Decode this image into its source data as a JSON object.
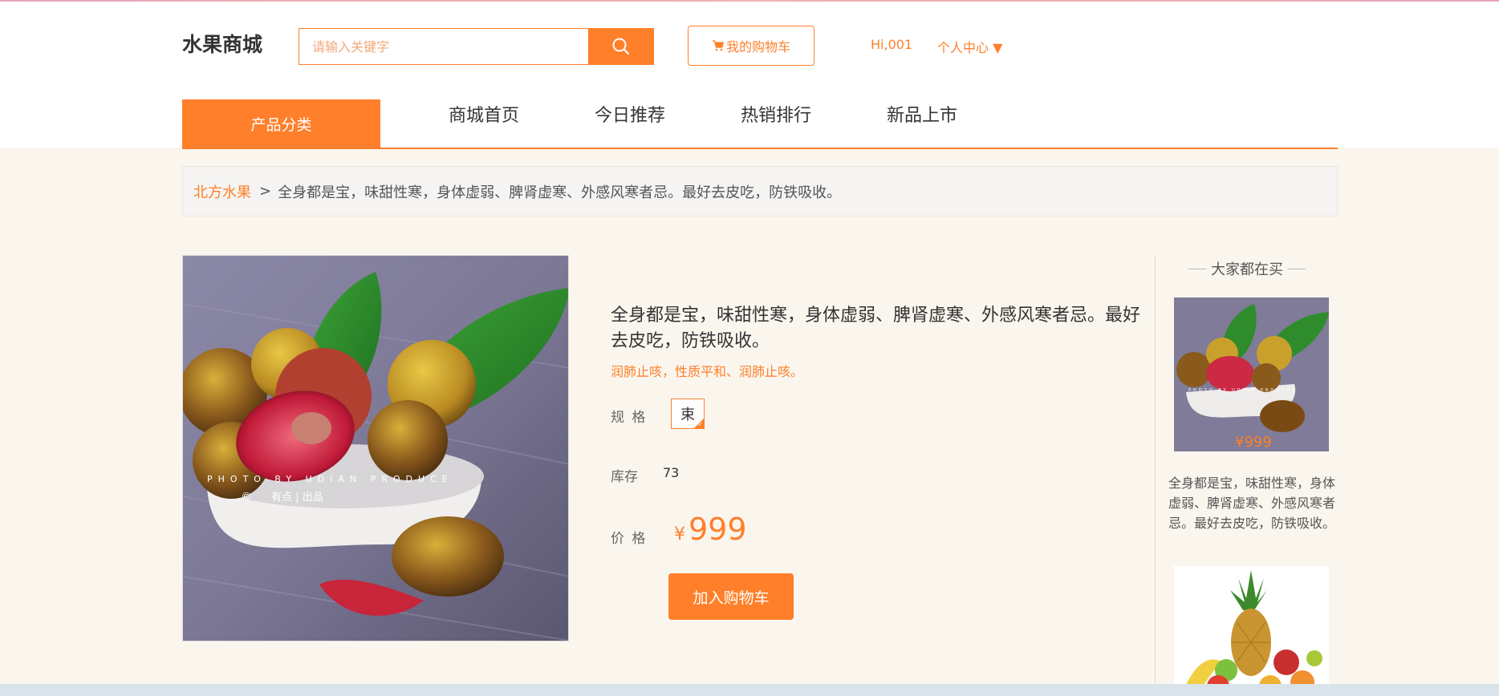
{
  "header": {
    "logo": "水果商城",
    "search_placeholder": "请输入关键字",
    "cart_label": "我的购物车",
    "greeting": "Hi,001",
    "user_center": "个人中心 ▼"
  },
  "nav": {
    "category": "产品分类",
    "items": [
      "商城首页",
      "今日推荐",
      "热销排行",
      "新品上市"
    ]
  },
  "breadcrumb": {
    "category": "北方水果",
    "separator": ">",
    "current": "全身都是宝，味甜性寒，身体虚弱、脾肾虚寒、外感风寒者忌。最好去皮吃，防铁吸收。"
  },
  "product": {
    "photo_caption": "PHOTO BY UDIAN PRODUCE",
    "photo_mark": "有点 | 出品",
    "title": "全身都是宝，味甜性寒，身体虚弱、脾肾虚寒、外感风寒者忌。最好去皮吃，防铁吸收。",
    "subtitle": "润肺止咳，性质平和、润肺止咳。",
    "spec_label": "规 格",
    "spec_value": "束",
    "stock_label": "库存",
    "stock_value": "73",
    "price_label": "价 格",
    "currency": "¥",
    "price": "999",
    "add_cart": "加入购物车"
  },
  "sidebar": {
    "title": "大家都在买",
    "item1_price": "¥999",
    "item1_text": "全身都是宝，味甜性寒，身体虚弱、脾肾虚寒、外感风寒者忌。最好去皮吃，防铁吸收。"
  },
  "colors": {
    "accent": "#ff7f2a",
    "background": "#faf6ee"
  }
}
